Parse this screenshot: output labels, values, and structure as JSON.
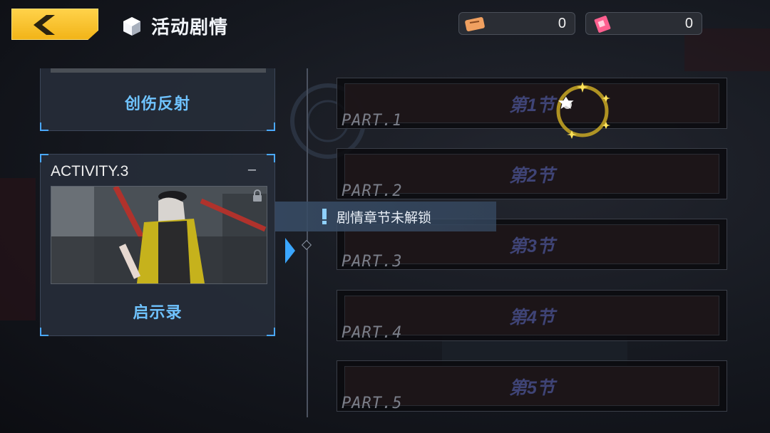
{
  "header": {
    "back_icon": "chevron-left-icon",
    "title_icon": "cube-icon",
    "title": "活动剧情",
    "currencies": [
      {
        "icon": "ticket-icon",
        "value": "0",
        "color": "#f0a060"
      },
      {
        "icon": "card-icon",
        "value": "0",
        "color": "#ff5f8f"
      }
    ]
  },
  "activities": [
    {
      "name": "创伤反射"
    },
    {
      "code": "ACTIVITY.3",
      "status": "–",
      "name": "启示录"
    }
  ],
  "tip": {
    "text": "剧情章节未解锁"
  },
  "parts": [
    {
      "title": "第1节",
      "label": "PART.1"
    },
    {
      "title": "第2节",
      "label": "PART.2"
    },
    {
      "title": "第3节",
      "label": "PART.3"
    },
    {
      "title": "第4节",
      "label": "PART.4"
    },
    {
      "title": "第5节",
      "label": "PART.5"
    }
  ],
  "colors": {
    "accent": "#f2b418",
    "link": "#6fc3ff",
    "frame": "#4aa8ff"
  }
}
